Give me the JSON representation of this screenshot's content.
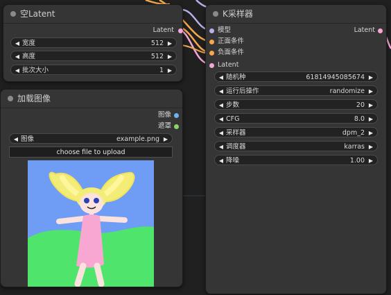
{
  "nodes": {
    "empty_latent": {
      "title": "空Latent",
      "output_label": "Latent",
      "widgets": [
        {
          "label": "宽度",
          "value": "512"
        },
        {
          "label": "高度",
          "value": "512"
        },
        {
          "label": "批次大小",
          "value": "1"
        }
      ]
    },
    "load_image": {
      "title": "加载图像",
      "outputs": [
        "图像",
        "遮罩"
      ],
      "widget": {
        "label": "图像",
        "value": "example.png"
      },
      "upload_button": "choose file to upload"
    },
    "ksampler": {
      "title": "K采样器",
      "inputs": [
        "模型",
        "正面条件",
        "负面条件",
        "Latent"
      ],
      "output_label": "Latent",
      "widgets": [
        {
          "label": "随机种",
          "value": "61814945085674"
        },
        {
          "label": "运行后操作",
          "value": "randomize"
        },
        {
          "label": "步数",
          "value": "20"
        },
        {
          "label": "CFG",
          "value": "8.0"
        },
        {
          "label": "采样器",
          "value": "dpm_2"
        },
        {
          "label": "调度器",
          "value": "karras"
        },
        {
          "label": "降噪",
          "value": "1.00"
        }
      ]
    }
  },
  "colors": {
    "latent_pin": "#f4a6d6",
    "model_pin": "#b8b0e8",
    "conditioning_pin": "#f6a94a",
    "image_pin": "#6fb2f2",
    "mask_pin": "#8ad26a"
  },
  "icons": {
    "left_arrow": "◀",
    "right_arrow": "▶"
  }
}
